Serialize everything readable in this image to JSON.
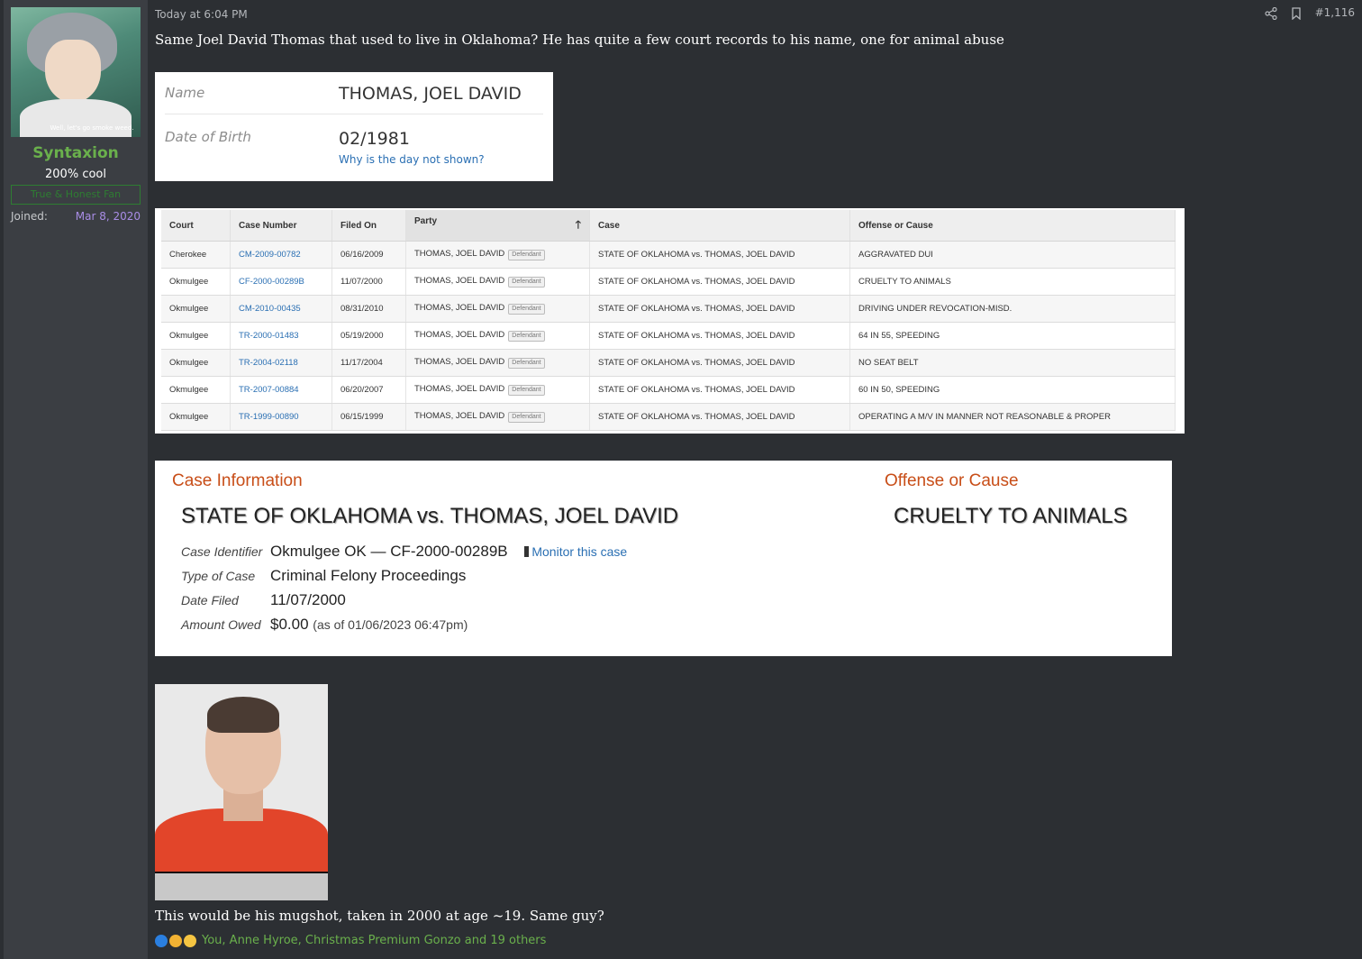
{
  "user": {
    "avatar_caption": "Well, let's go smoke weed.",
    "name": "Syntaxion",
    "title": "200% cool",
    "banner": "True & Honest Fan",
    "joined_label": "Joined:",
    "joined_value": "Mar 8, 2020"
  },
  "post": {
    "date": "Today at 6:04 PM",
    "number": "#1,116",
    "text_top": "Same Joel David Thomas that used to live in Oklahoma? He has quite a few court records to his name, one for animal abuse",
    "text_bottom": "This would be his mugshot, taken in 2000 at age ~19. Same guy?",
    "reactions_text": "You, Anne Hyroe, Christmas Premium Gonzo and 19 others"
  },
  "record": {
    "name_label": "Name",
    "name_value": "THOMAS, JOEL DAVID",
    "dob_label": "Date of Birth",
    "dob_value": "02/1981",
    "dob_link": "Why is the day not shown?"
  },
  "cases_table": {
    "headers": [
      "Court",
      "Case Number",
      "Filed On",
      "Party",
      "Case",
      "Offense or Cause"
    ],
    "sort_arrow": "🡑",
    "badge": "Defendant",
    "rows": [
      [
        "Cherokee",
        "CM-2009-00782",
        "06/16/2009",
        "THOMAS, JOEL DAVID",
        "STATE OF OKLAHOMA vs. THOMAS, JOEL DAVID",
        "AGGRAVATED DUI"
      ],
      [
        "Okmulgee",
        "CF-2000-00289B",
        "11/07/2000",
        "THOMAS, JOEL DAVID",
        "STATE OF OKLAHOMA vs. THOMAS, JOEL DAVID",
        "CRUELTY TO ANIMALS"
      ],
      [
        "Okmulgee",
        "CM-2010-00435",
        "08/31/2010",
        "THOMAS, JOEL DAVID",
        "STATE OF OKLAHOMA vs. THOMAS, JOEL DAVID",
        "DRIVING UNDER REVOCATION-MISD."
      ],
      [
        "Okmulgee",
        "TR-2000-01483",
        "05/19/2000",
        "THOMAS, JOEL DAVID",
        "STATE OF OKLAHOMA vs. THOMAS, JOEL DAVID",
        "64 IN 55, SPEEDING"
      ],
      [
        "Okmulgee",
        "TR-2004-02118",
        "11/17/2004",
        "THOMAS, JOEL DAVID",
        "STATE OF OKLAHOMA vs. THOMAS, JOEL DAVID",
        "NO SEAT BELT"
      ],
      [
        "Okmulgee",
        "TR-2007-00884",
        "06/20/2007",
        "THOMAS, JOEL DAVID",
        "STATE OF OKLAHOMA vs. THOMAS, JOEL DAVID",
        "60 IN 50, SPEEDING"
      ],
      [
        "Okmulgee",
        "TR-1999-00890",
        "06/15/1999",
        "THOMAS, JOEL DAVID",
        "STATE OF OKLAHOMA vs. THOMAS, JOEL DAVID",
        "OPERATING A M/V IN MANNER NOT REASONABLE & PROPER"
      ]
    ]
  },
  "case_info": {
    "heading": "Case Information",
    "title": "STATE OF OKLAHOMA vs. THOMAS, JOEL DAVID",
    "offense_heading": "Offense or Cause",
    "offense": "CRUELTY TO ANIMALS",
    "identifier_label": "Case Identifier",
    "identifier_value": "Okmulgee OK — CF-2000-00289B",
    "monitor": "Monitor this case",
    "type_label": "Type of Case",
    "type_value": "Criminal Felony Proceedings",
    "date_label": "Date Filed",
    "date_value": "11/07/2000",
    "amount_label": "Amount Owed",
    "amount_value": "$0.00",
    "amount_note": "(as of 01/06/2023 06:47pm)"
  },
  "icons": [
    "share-icon",
    "bookmark-icon",
    "info-reaction-icon",
    "thumbs-reaction-icon",
    "thinking-reaction-icon"
  ],
  "colors": {
    "background": "#2c2f33",
    "sidebar": "#3b3e43",
    "username": "#6ab04c",
    "joined": "#a98de6",
    "link": "#2a6fb3",
    "case_heading": "#c84e18"
  }
}
